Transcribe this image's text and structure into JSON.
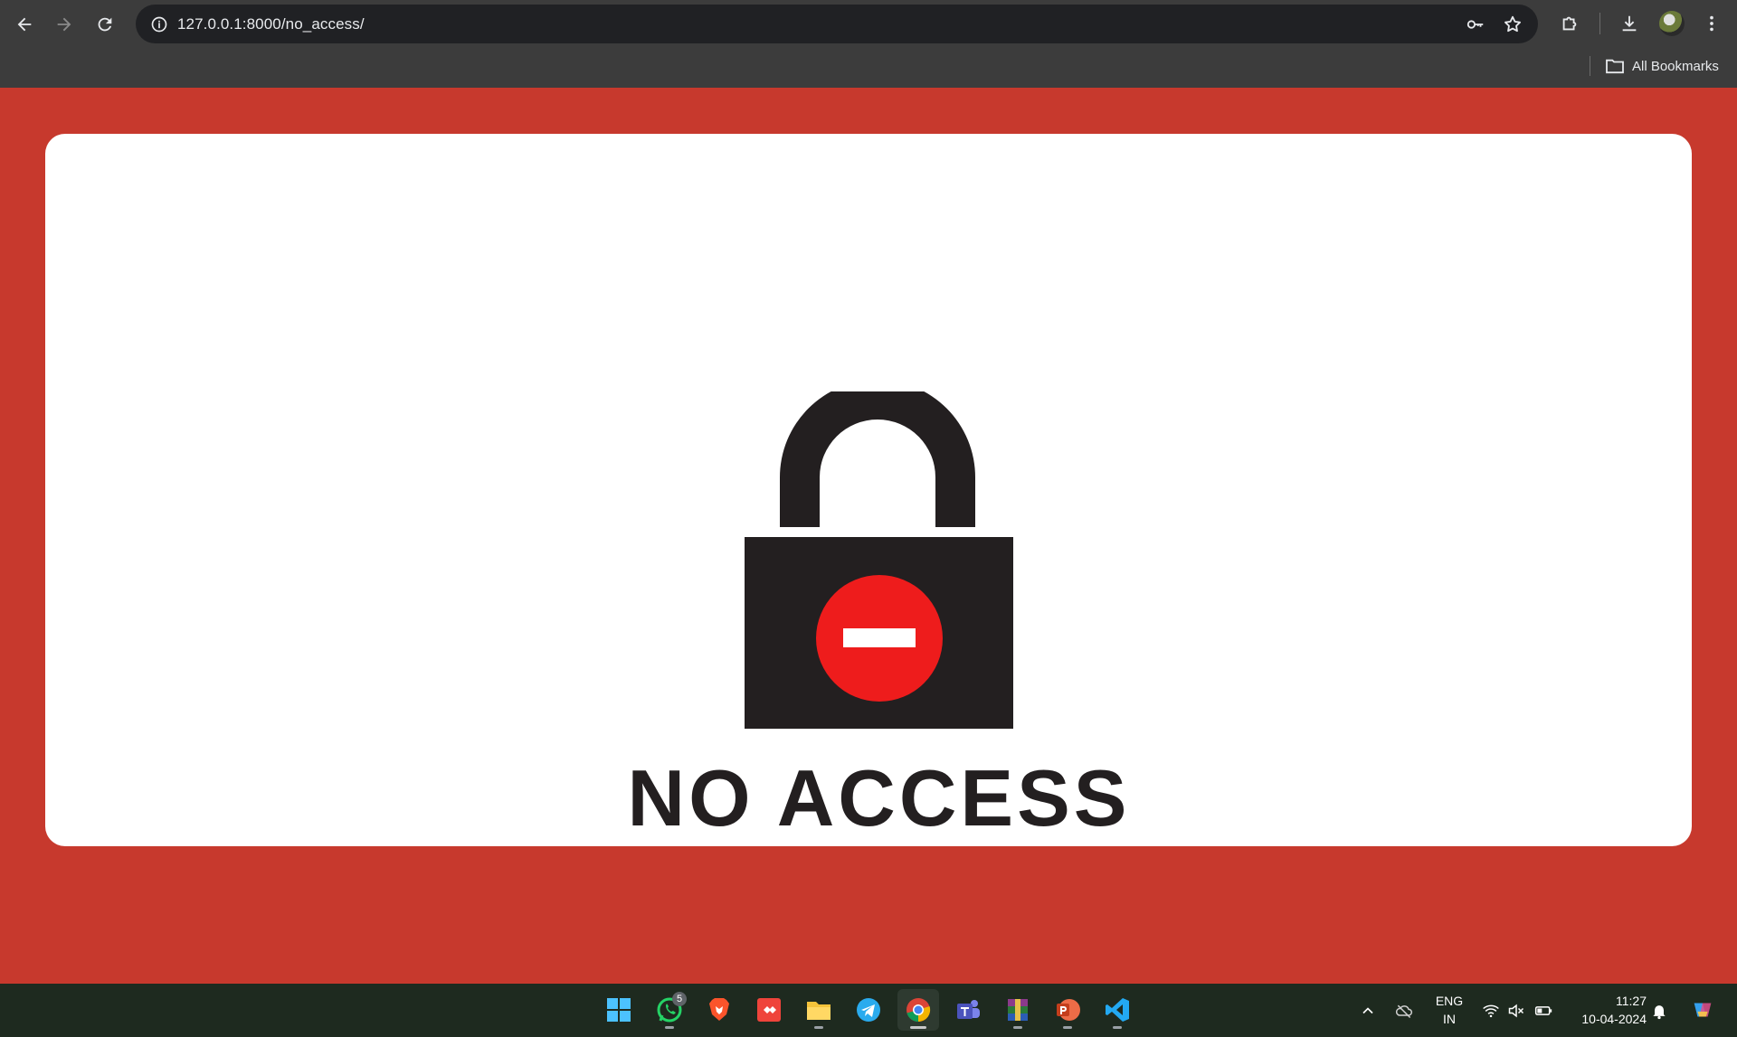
{
  "browser": {
    "url": "127.0.0.1:8000/no_access/",
    "bookmarks_label": "All Bookmarks"
  },
  "page": {
    "heading": "NO ACCESS"
  },
  "taskbar": {
    "apps": [
      "start-icon",
      "whatsapp-icon",
      "brave-icon",
      "anydesk-icon",
      "file-explorer-icon",
      "telegram-icon",
      "chrome-icon",
      "teams-icon",
      "winrar-icon",
      "powerpoint-icon",
      "vscode-icon"
    ],
    "whatsapp_badge": "5",
    "language_line1": "ENG",
    "language_line2": "IN",
    "time": "11:27",
    "date": "10-04-2024"
  },
  "colors": {
    "page_background": "#c7392d",
    "card_background": "#ffffff",
    "lock_body": "#231f20",
    "no_entry_red": "#ee1c1c"
  }
}
